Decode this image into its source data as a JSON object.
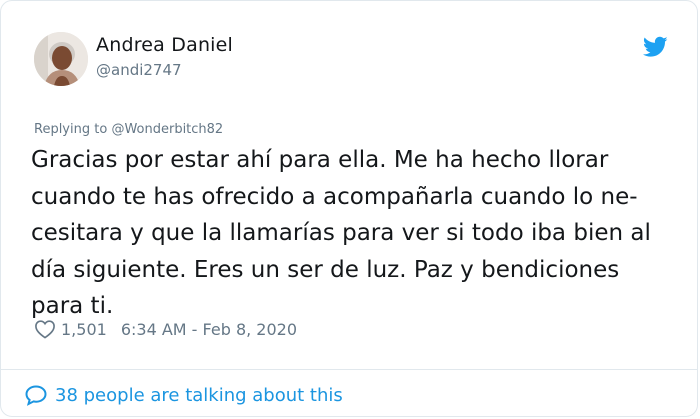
{
  "author": {
    "name": "Andrea Daniel",
    "handle": "@andi2747"
  },
  "reply": {
    "prefix": "Replying to",
    "mention": "@Wonderbitch82"
  },
  "tweet": {
    "text": "Gracias por estar ahí para ella. Me ha hecho llorar\ncuando te has ofrecido a acompañarla cuando lo ne-\ncesitara y que la llamarías para ver si todo iba bien al\ndía siguiente. Eres un ser de luz. Paz y bendiciones\npara ti."
  },
  "meta": {
    "likes": "1,501",
    "timestamp": "6:34 AM - Feb 8, 2020"
  },
  "footer": {
    "talking": "38 people are talking about this"
  },
  "colors": {
    "accent": "#1b95e0",
    "twitter_blue": "#1da1f2",
    "muted": "#657786",
    "text": "#14171a"
  },
  "icons": {
    "brand": "twitter-bird-icon",
    "like": "heart-icon",
    "conversation": "speech-bubble-icon"
  }
}
